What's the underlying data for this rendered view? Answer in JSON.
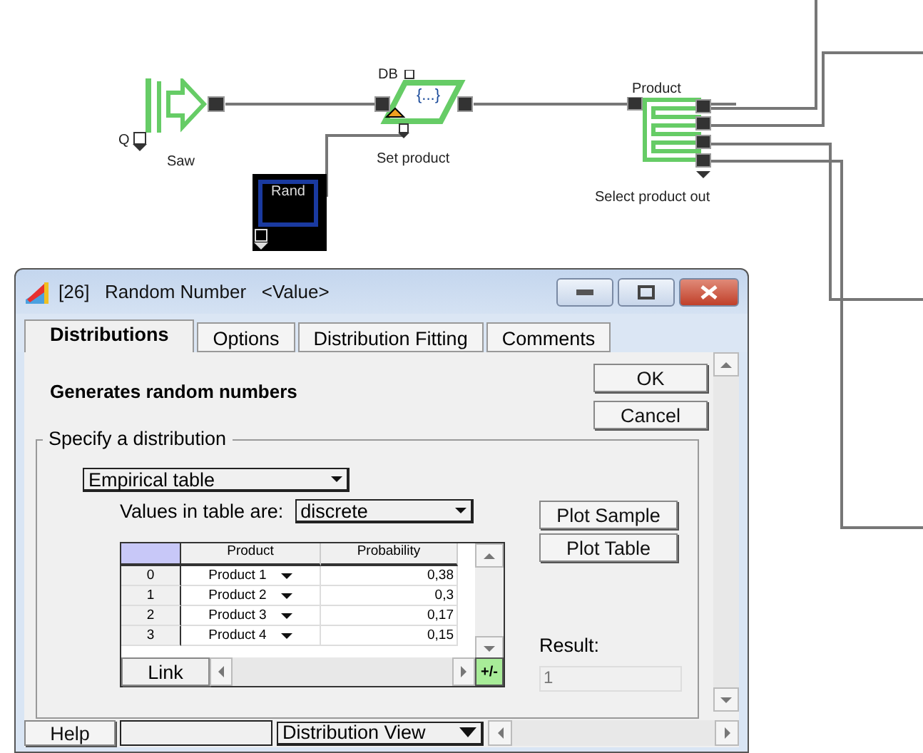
{
  "diagram": {
    "blocks": [
      {
        "kind": "source",
        "label": "Saw",
        "port_label": "Q"
      },
      {
        "kind": "set",
        "label": "Set product",
        "top_label": "DB",
        "icon_text": "{...}"
      },
      {
        "kind": "random",
        "label": "Rand"
      },
      {
        "kind": "select",
        "label": "Select product out",
        "top_label": "Product"
      }
    ]
  },
  "dialog": {
    "title_id": "[26]",
    "title": "Random Number",
    "title_value": "<Value>",
    "tabs": [
      {
        "label": "Distributions",
        "selected": true
      },
      {
        "label": "Options",
        "selected": false
      },
      {
        "label": "Distribution Fitting",
        "selected": false
      },
      {
        "label": "Comments",
        "selected": false
      }
    ],
    "description": "Generates random numbers",
    "ok_button": "OK",
    "cancel_button": "Cancel",
    "group_title": "Specify a distribution",
    "distribution": "Empirical table",
    "values_label": "Values in table are:",
    "values_type": "discrete",
    "plot_sample_button": "Plot Sample",
    "plot_table_button": "Plot Table",
    "table": {
      "columns": [
        "Product",
        "Probability"
      ],
      "rows": [
        {
          "index": "0",
          "product": "Product 1",
          "probability": "0,38"
        },
        {
          "index": "1",
          "product": "Product 2",
          "probability": "0,3"
        },
        {
          "index": "2",
          "product": "Product 3",
          "probability": "0,17"
        },
        {
          "index": "3",
          "product": "Product 4",
          "probability": "0,15"
        }
      ]
    },
    "link_button": "Link",
    "add_remove_button": "+/-",
    "result_label": "Result:",
    "result_value": "1",
    "help_button": "Help",
    "view_select": "Distribution View"
  }
}
